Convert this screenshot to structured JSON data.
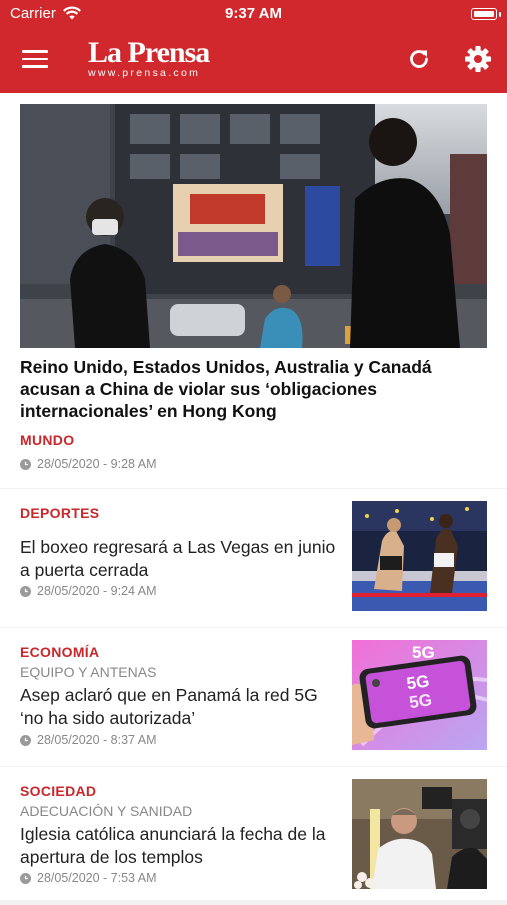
{
  "status_bar": {
    "carrier": "Carrier",
    "time": "9:37 AM"
  },
  "header": {
    "logo": "La Prensa",
    "logo_url": "www.prensa.com"
  },
  "featured": {
    "title": "Reino Unido, Estados Unidos, Australia y Canadá acusan a China de violar sus ‘obligaciones internacionales’ en Hong Kong",
    "section": "MUNDO",
    "date": "28/05/2020 - 9:28 AM"
  },
  "articles": [
    {
      "section": "DEPORTES",
      "subsection": "",
      "title": "El boxeo regresará a Las Vegas en junio a puerta cerrada",
      "date": "28/05/2020 - 9:24 AM"
    },
    {
      "section": "ECONOMÍA",
      "subsection": "EQUIPO Y ANTENAS",
      "title": "Asep aclaró que en Panamá la red 5G ‘no ha sido autorizada’",
      "date": "28/05/2020 - 8:37 AM"
    },
    {
      "section": "SOCIEDAD",
      "subsection": "ADECUACIÓN Y SANIDAD",
      "title": "Iglesia católica anunciará la fecha de la apertura de los templos",
      "date": "28/05/2020 - 7:53 AM"
    }
  ],
  "colors": {
    "brand": "#d0282c",
    "section": "#c8272b"
  },
  "icons": [
    "wifi-icon",
    "battery-icon",
    "menu-icon",
    "refresh-icon",
    "settings-icon",
    "clock-icon"
  ]
}
